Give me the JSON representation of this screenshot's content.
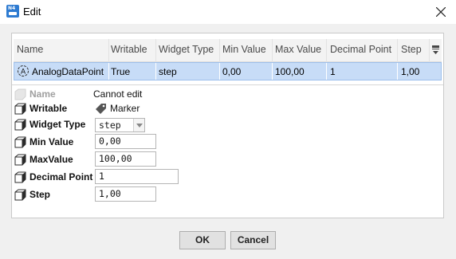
{
  "window": {
    "title": "Edit",
    "app_icon_text": "N4"
  },
  "table": {
    "columns": [
      "Name",
      "Writable",
      "Widget Type",
      "Min Value",
      "Max Value",
      "Decimal Point",
      "Step"
    ],
    "row": {
      "name": "AnalogDataPoint",
      "writable": "True",
      "widget_type": "step",
      "min_value": "0,00",
      "max_value": "100,00",
      "decimal_point": "1",
      "step": "1,00"
    }
  },
  "properties": {
    "name": {
      "label": "Name",
      "value": "Cannot edit"
    },
    "writable": {
      "label": "Writable",
      "value": "Marker"
    },
    "widget_type": {
      "label": "Widget Type",
      "value": "step"
    },
    "min_value": {
      "label": "Min Value",
      "value": "0,00"
    },
    "max_value": {
      "label": "MaxValue",
      "value": "100,00"
    },
    "decimal_point": {
      "label": "Decimal Point",
      "value": "1"
    },
    "step": {
      "label": "Step",
      "value": "1,00"
    }
  },
  "buttons": {
    "ok": "OK",
    "cancel": "Cancel"
  },
  "colors": {
    "selection": "#c7dcf7",
    "accent": "#2e7bd1",
    "cube_dark": "#2b2b2b"
  },
  "icons": {
    "close": "close-icon",
    "column_chooser": "column-chooser-icon",
    "analog": "analog-point-icon",
    "marker": "tag-icon",
    "property": "cube-icon"
  }
}
